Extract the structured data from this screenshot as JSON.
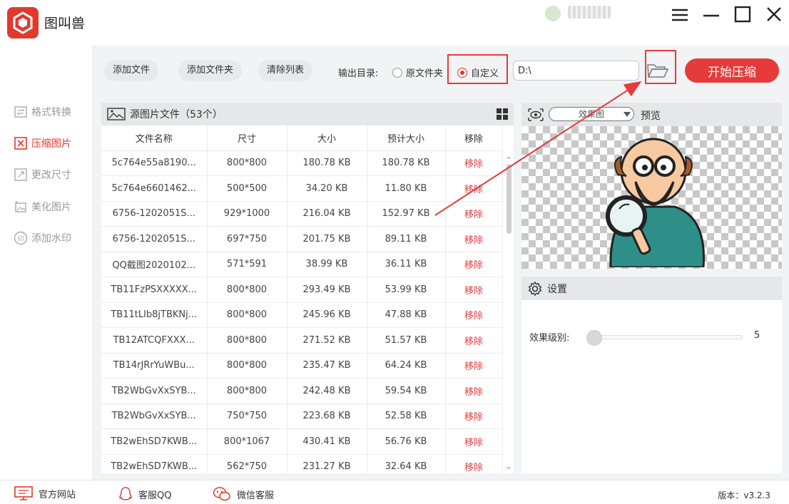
{
  "app": {
    "name": "图叫兽"
  },
  "sidebar": {
    "items": [
      {
        "label": "格式转换",
        "active": false
      },
      {
        "label": "压缩图片",
        "active": true
      },
      {
        "label": "更改尺寸",
        "active": false
      },
      {
        "label": "美化图片",
        "active": false
      },
      {
        "label": "添加水印",
        "active": false
      }
    ]
  },
  "toolbar": {
    "add_file": "添加文件",
    "add_folder": "添加文件夹",
    "clear_list": "清除列表",
    "output_label": "输出目录:",
    "radio_original": "原文件夹",
    "radio_custom": "自定义",
    "selected_radio": "自定义",
    "path_value": "D:\\",
    "start": "开始压缩"
  },
  "file_list": {
    "title": "源图片文件（53个）",
    "columns": [
      "文件名称",
      "尺寸",
      "大小",
      "预计大小",
      "移除"
    ],
    "rows": [
      [
        "5c764e55a8190...",
        "800*800",
        "180.78 KB",
        "180.78 KB",
        "移除"
      ],
      [
        "5c764e6601462...",
        "500*500",
        "34.20 KB",
        "11.80 KB",
        "移除"
      ],
      [
        "6756-1202051S...",
        "929*1000",
        "216.04 KB",
        "152.97 KB",
        "移除"
      ],
      [
        "6756-1202051S...",
        "697*750",
        "201.75 KB",
        "89.11 KB",
        "移除"
      ],
      [
        "QQ截图2020102...",
        "571*591",
        "38.99 KB",
        "36.11 KB",
        "移除"
      ],
      [
        "TB11FzPSXXXXX...",
        "800*800",
        "293.49 KB",
        "53.99 KB",
        "移除"
      ],
      [
        "TB11tLIb8jTBKNj...",
        "800*800",
        "245.96 KB",
        "47.88 KB",
        "移除"
      ],
      [
        "TB12ATCQFXXX...",
        "800*800",
        "271.52 KB",
        "51.57 KB",
        "移除"
      ],
      [
        "TB14rJRrYuWBu...",
        "800*800",
        "235.47 KB",
        "64.24 KB",
        "移除"
      ],
      [
        "TB2WbGvXxSYB...",
        "800*800",
        "242.48 KB",
        "59.54 KB",
        "移除"
      ],
      [
        "TB2WbGvXxSYB...",
        "750*750",
        "223.68 KB",
        "52.58 KB",
        "移除"
      ],
      [
        "TB2wEhSD7KWB...",
        "800*1067",
        "430.41 KB",
        "56.76 KB",
        "移除"
      ],
      [
        "TB2wEhSD7KWB...",
        "562*750",
        "231.27 KB",
        "32.64 KB",
        "移除"
      ]
    ]
  },
  "preview": {
    "mode": "效果图",
    "label": "预览"
  },
  "settings": {
    "title": "设置",
    "effect_label": "效果级别:",
    "effect_value": "5"
  },
  "footer": {
    "website": "官方网站",
    "qq": "客服QQ",
    "wechat": "微信客服",
    "version": "版本：v3.2.3"
  },
  "colors": {
    "accent": "#e53b3b",
    "panel_header": "#e6e7ea",
    "background": "#f2f3f5"
  }
}
